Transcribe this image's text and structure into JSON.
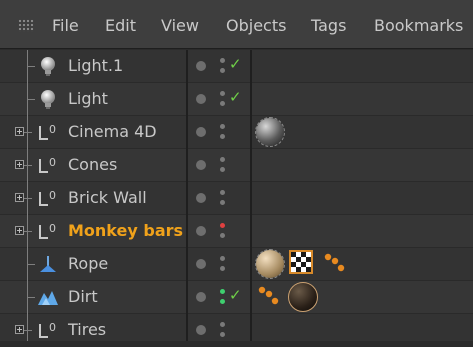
{
  "menu": {
    "items": [
      "File",
      "Edit",
      "View",
      "Objects",
      "Tags",
      "Bookmarks"
    ]
  },
  "objects": [
    {
      "name": "Light.1",
      "type": "light-icon",
      "expandable": false,
      "selected": false,
      "vis_editor": "#7a7a7a",
      "vis_render": "#7a7a7a",
      "enabled": true,
      "tags": []
    },
    {
      "name": "Light",
      "type": "light-icon",
      "expandable": false,
      "selected": false,
      "vis_editor": "#7a7a7a",
      "vis_render": "#7a7a7a",
      "enabled": true,
      "tags": []
    },
    {
      "name": "Cinema 4D",
      "type": "null-object-icon",
      "expandable": true,
      "selected": false,
      "vis_editor": "#7a7a7a",
      "vis_render": "#7a7a7a",
      "enabled": false,
      "tags": [
        "phong-material-tag"
      ]
    },
    {
      "name": "Cones",
      "type": "null-object-icon",
      "expandable": true,
      "selected": false,
      "vis_editor": "#7a7a7a",
      "vis_render": "#7a7a7a",
      "enabled": false,
      "tags": []
    },
    {
      "name": "Brick Wall",
      "type": "null-object-icon",
      "expandable": true,
      "selected": false,
      "vis_editor": "#7a7a7a",
      "vis_render": "#7a7a7a",
      "enabled": false,
      "tags": []
    },
    {
      "name": "Monkey bars",
      "type": "null-object-icon",
      "expandable": true,
      "selected": true,
      "vis_editor": "#e04040",
      "vis_render": "#7a7a7a",
      "enabled": false,
      "tags": []
    },
    {
      "name": "Rope",
      "type": "spline-icon",
      "expandable": false,
      "selected": false,
      "vis_editor": "#7a7a7a",
      "vis_render": "#7a7a7a",
      "enabled": false,
      "tags": [
        "material-tag-beige",
        "texture-tag-checker",
        "selection-tag-orange"
      ]
    },
    {
      "name": "Dirt",
      "type": "landscape-icon",
      "expandable": false,
      "selected": false,
      "vis_editor": "#3fcf6f",
      "vis_render": "#3fcf6f",
      "enabled": true,
      "tags": [
        "selection-tag-orange",
        "material-tag-dark"
      ]
    },
    {
      "name": "Tires",
      "type": "null-object-icon",
      "expandable": true,
      "selected": false,
      "vis_editor": "#7a7a7a",
      "vis_render": "#7a7a7a",
      "enabled": false,
      "tags": []
    }
  ],
  "colors": {
    "selected_label": "#f0a21b",
    "enabled_check": "#6fcf48"
  }
}
